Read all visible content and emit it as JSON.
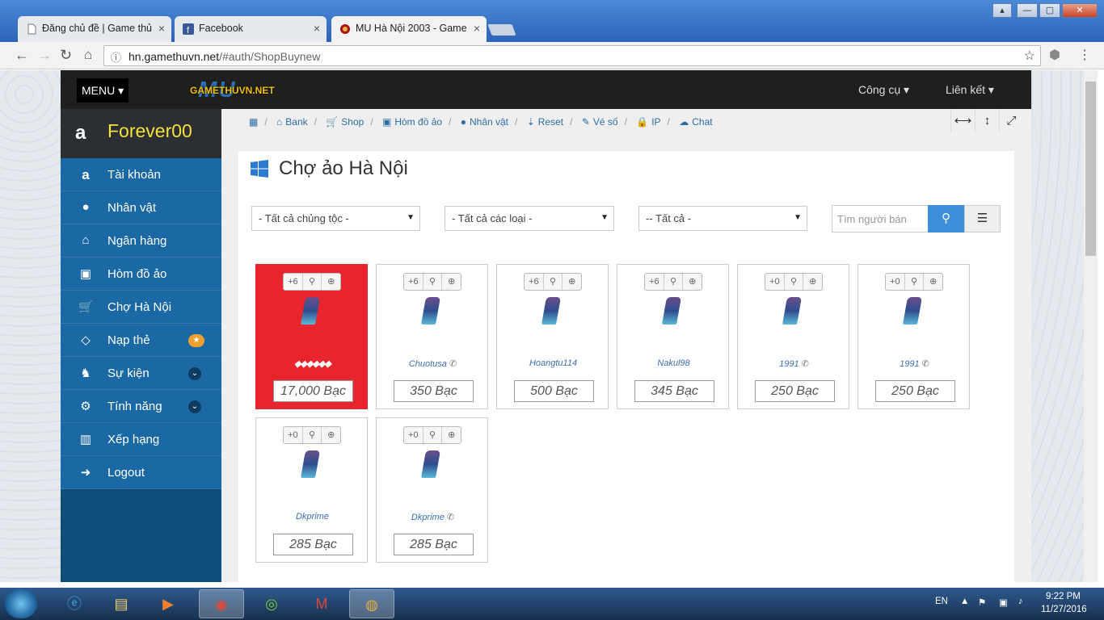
{
  "browser": {
    "tabs": [
      {
        "title": "Đăng chủ đề | Game thủ"
      },
      {
        "title": "Facebook"
      },
      {
        "title": "MU Hà Nội 2003 - Game"
      }
    ],
    "url_host": "hn.gamethuvn.net",
    "url_path": "/#auth/ShopBuynew"
  },
  "site": {
    "menu_label": "MENU ▾",
    "logo_big": "MU",
    "logo_small": "GAMETHUVN.NET",
    "nav_tools": "Công cụ ▾",
    "nav_links": "Liên kết ▾"
  },
  "sidebar": {
    "username": "Forever00",
    "items": [
      {
        "label": "Tài khoản",
        "icon": "amazon-icon"
      },
      {
        "label": "Nhân vật",
        "icon": "user-icon"
      },
      {
        "label": "Ngân hàng",
        "icon": "bank-icon"
      },
      {
        "label": "Hòm đồ ảo",
        "icon": "briefcase-icon"
      },
      {
        "label": "Chợ Hà Nội",
        "icon": "cart-icon"
      },
      {
        "label": "Nạp thẻ",
        "icon": "diamond-icon",
        "badge": "★"
      },
      {
        "label": "Sự kiện",
        "icon": "android-icon",
        "badge": "⌄"
      },
      {
        "label": "Tính năng",
        "icon": "gears-icon",
        "badge": "⌄"
      },
      {
        "label": "Xếp hạng",
        "icon": "chart-icon"
      },
      {
        "label": "Logout",
        "icon": "sign-out-icon"
      }
    ]
  },
  "breadcrumbs": [
    "Bank",
    "Shop",
    "Hòm đồ ảo",
    "Nhân vật",
    "Reset",
    "Vé số",
    "IP",
    "Chat"
  ],
  "panel": {
    "title": "Chợ ảo Hà Nội",
    "filters": [
      "- Tất cả chủng tộc -",
      "- Tất cả các loại -",
      "-- Tất cả -"
    ],
    "search_placeholder": "Tìm người bán"
  },
  "listings": [
    {
      "level": "+6",
      "seller": "",
      "price": "17,000 Bạc",
      "hot": true,
      "phone": false
    },
    {
      "level": "+6",
      "seller": "Chuotusa",
      "price": "350 Bạc",
      "phone": true
    },
    {
      "level": "+6",
      "seller": "Hoangtu114",
      "price": "500 Bạc",
      "phone": false
    },
    {
      "level": "+6",
      "seller": "Nakul98",
      "price": "345 Bạc",
      "phone": false
    },
    {
      "level": "+0",
      "seller": "1991",
      "price": "250 Bạc",
      "phone": true
    },
    {
      "level": "+0",
      "seller": "1991",
      "price": "250 Bạc",
      "phone": true
    },
    {
      "level": "+0",
      "seller": "Dkprime",
      "price": "285 Bạc",
      "phone": false
    },
    {
      "level": "+0",
      "seller": "Dkprime",
      "price": "285 Bạc",
      "phone": true
    }
  ],
  "taskbar": {
    "lang": "EN",
    "time": "9:22 PM",
    "date": "11/27/2016"
  }
}
